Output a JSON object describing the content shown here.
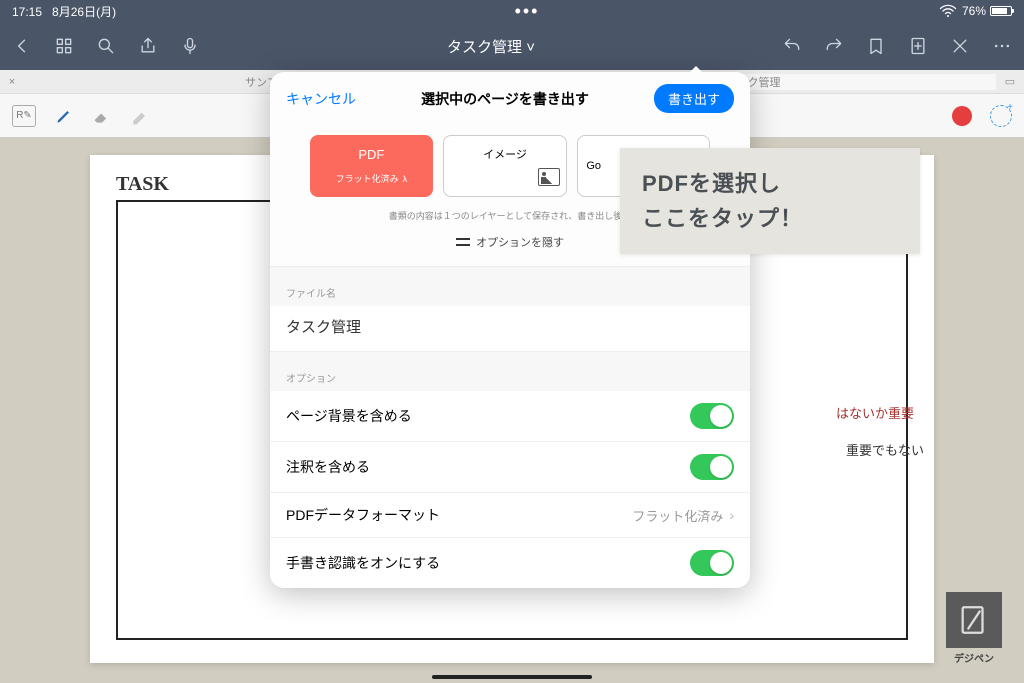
{
  "status": {
    "time": "17:15",
    "date": "8月26日(月)",
    "battery_pct": "76%"
  },
  "toolbar": {
    "title": "タスク管理 ˅"
  },
  "tabs": {
    "left": "サンプル",
    "right": "タスク管理"
  },
  "canvas": {
    "task_label": "TASK"
  },
  "side_notes": {
    "red": "はないか重要",
    "black": "重要でもない"
  },
  "modal": {
    "cancel": "キャンセル",
    "title": "選択中のページを書き出す",
    "export": "書き出す",
    "formats": {
      "pdf": "PDF",
      "pdf_sub": "フラット化済み",
      "image": "イメージ",
      "google": "Go"
    },
    "note": "書類の内容は１つのレイヤーとして保存され、書き出し後…",
    "hide_options": "オプションを隠す",
    "filename_label": "ファイル名",
    "filename_value": "タスク管理",
    "options_label": "オプション",
    "opt_bg": "ページ背景を含める",
    "opt_annot": "注釈を含める",
    "opt_fmt": "PDFデータフォーマット",
    "opt_fmt_val": "フラット化済み",
    "opt_hw": "手書き認識をオンにする"
  },
  "callout": {
    "line1": "PDFを選択し",
    "line2": "ここをタップ！"
  },
  "watermark": {
    "label": "デジペン"
  }
}
